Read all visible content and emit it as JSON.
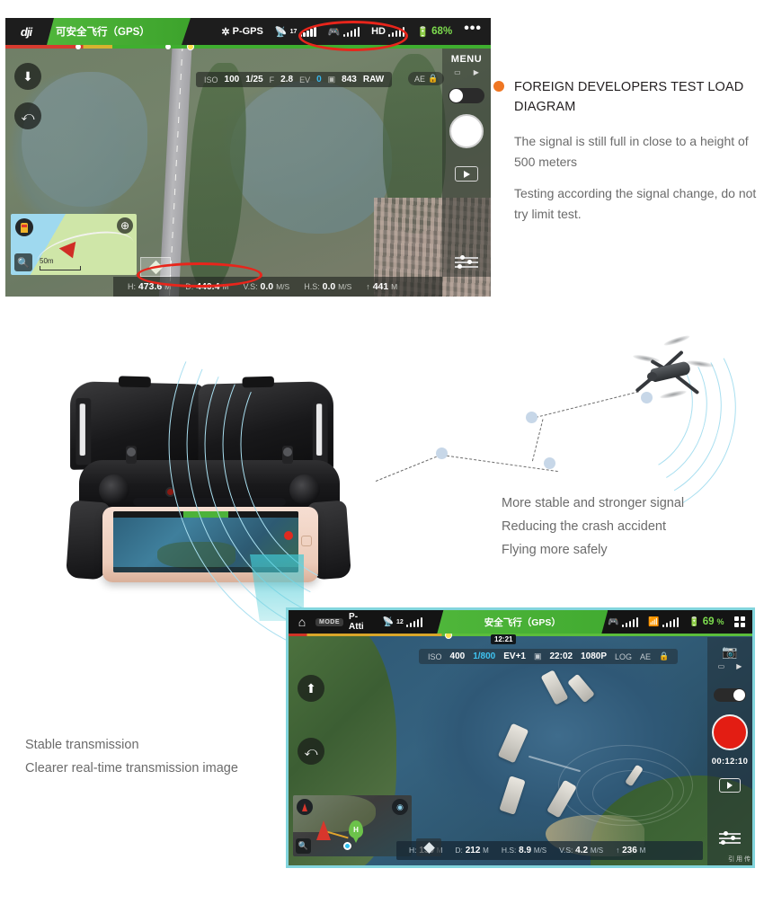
{
  "top_screenshot": {
    "brand": "dji",
    "status_banner": "可安全飞行（GPS）",
    "flight_mode": "P-GPS",
    "satellite_count": "17",
    "hd_label": "HD",
    "battery": "68%",
    "more_menu": "•••",
    "camera": {
      "iso_label": "ISO",
      "iso_value": "100",
      "shutter": "1/25",
      "aperture_label": "F",
      "aperture": "2.8",
      "ev_label": "EV",
      "ev_value": "0",
      "shots_remaining": "843",
      "format": "RAW",
      "ae_lock": "AE"
    },
    "sidebar": {
      "menu_label": "MENU",
      "photo_icon": "photo-icon",
      "video_icon": "video-icon",
      "shutter_button": "shutter-button",
      "playback": "playback-button",
      "settings": "settings-sliders"
    },
    "left_controls": {
      "auto_takeoff": "auto-takeoff-icon",
      "return_home": "return-to-home-icon"
    },
    "minimap": {
      "home_marker": "home-marker",
      "aircraft_marker": "aircraft-marker",
      "recenter": "recenter-icon",
      "zoom": "zoom-icon",
      "scale": "50m"
    },
    "telemetry": {
      "height_label": "H:",
      "height_value": "473.6",
      "height_unit": "M",
      "distance_label": "D:",
      "distance_value": "440.4",
      "distance_unit": "M",
      "vs_label": "V.S:",
      "vs_value": "0.0",
      "vs_unit": "M/S",
      "hs_label": "H.S:",
      "hs_value": "0.0",
      "hs_unit": "M/S",
      "alt_label": "↑",
      "alt_value": "441",
      "alt_unit": "M"
    },
    "annotations": [
      "red-ellipse-signal-icons",
      "red-ellipse-telemetry"
    ]
  },
  "callout": {
    "title": "FOREIGN DEVELOPERS TEST LOAD DIAGRAM",
    "paragraphs": [
      "The signal is still full in close to a height of 500 meters",
      "Testing according the signal change, do not try limit test."
    ],
    "bullet_color": "#ef7622"
  },
  "middle_section": {
    "device_photo": "remote-controller-with-phone",
    "drone": "quadcopter-drone",
    "signal_waves": "signal-wave-arcs",
    "beam": "zoom-beam",
    "benefits": [
      "More stable and stronger signal",
      "Reducing the crash accident",
      "Flying more safely"
    ]
  },
  "bottom_left_text": {
    "lines": [
      "Stable transmission",
      "Clearer real-time transmission image"
    ]
  },
  "bottom_screenshot": {
    "home_icon": "home-icon",
    "mode_badge": "MODE",
    "flight_mode": "P-Atti",
    "satellite_count": "12",
    "status_banner": "安全飞行（GPS）",
    "battery": "69",
    "battery_unit": "%",
    "grid_icon": "grid-menu-icon",
    "timestamp": "12:21",
    "camera": {
      "iso_label": "ISO",
      "iso_value": "400",
      "shutter": "1/800",
      "ev": "EV+1",
      "duration": "22:02",
      "resolution": "1080P",
      "profile": "LOG",
      "ae_lock": "AE"
    },
    "left_controls": {
      "auto_takeoff": "auto-takeoff-icon",
      "return_home": "return-to-home-icon"
    },
    "minimap": {
      "compass": "compass-icon",
      "satellite": "satellite-view-icon",
      "aircraft_marker": "aircraft-marker",
      "home_pin": "H",
      "zoom": "zoom-icon"
    },
    "sidebar": {
      "camera_switch": "camera-switch-icon",
      "photo_icon": "photo-icon",
      "video_icon": "video-icon",
      "record_button": "record-button",
      "record_time": "00:12:10",
      "playback": "playback-button",
      "settings": "settings-sliders",
      "watermark": "引 用 传"
    },
    "telemetry": {
      "height_label": "H:",
      "height_value": "139",
      "height_unit": "M",
      "distance_label": "D:",
      "distance_value": "212",
      "distance_unit": "M",
      "hs_label": "H.S:",
      "hs_value": "8.9",
      "hs_unit": "M/S",
      "vs_label": "V.S:",
      "vs_value": "4.2",
      "vs_unit": "M/S",
      "alt_label": "↑",
      "alt_value": "236",
      "alt_unit": "M"
    },
    "border_color": "#83d5dd"
  }
}
